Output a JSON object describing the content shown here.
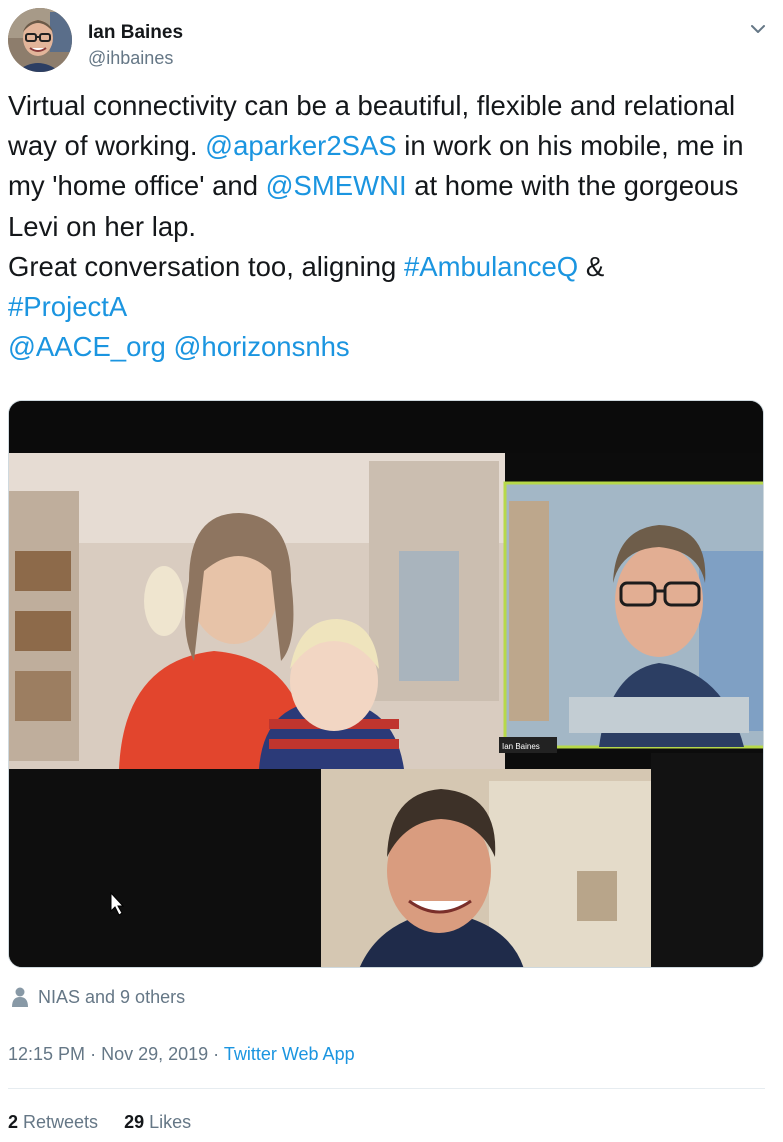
{
  "author": {
    "name": "Ian Baines",
    "handle": "@ihbaines"
  },
  "tweet": {
    "segments": [
      {
        "text": "Virtual connectivity can be a beautiful, flexible and relational way of working. ",
        "type": "text"
      },
      {
        "text": "@aparker2SAS",
        "type": "mention"
      },
      {
        "text": " in work on his mobile, me in my 'home office' and ",
        "type": "text"
      },
      {
        "text": "@SMEWNI",
        "type": "mention"
      },
      {
        "text": " at home with the gorgeous Levi on her lap.",
        "type": "text"
      },
      {
        "text": "\n",
        "type": "break"
      },
      {
        "text": "Great conversation too, aligning ",
        "type": "text"
      },
      {
        "text": "#AmbulanceQ",
        "type": "hashtag"
      },
      {
        "text": " &",
        "type": "text"
      },
      {
        "text": "\n",
        "type": "break"
      },
      {
        "text": "#ProjectA",
        "type": "hashtag"
      },
      {
        "text": "\n",
        "type": "break"
      },
      {
        "text": "@AACE_org",
        "type": "mention"
      },
      {
        "text": " ",
        "type": "text"
      },
      {
        "text": "@horizonsnhs",
        "type": "mention"
      }
    ]
  },
  "media": {
    "video_tile_label": "Ian Baines"
  },
  "likers": {
    "text": "NIAS and 9 others"
  },
  "meta": {
    "time": "12:15 PM",
    "separator": "·",
    "date": "Nov 29, 2019",
    "source": "Twitter Web App"
  },
  "stats": {
    "retweets_count": "2",
    "retweets_label": "Retweets",
    "likes_count": "29",
    "likes_label": "Likes"
  },
  "colors": {
    "link": "#1b95e0",
    "secondary": "#657786",
    "text": "#14171a",
    "active_speaker_border": "#b7d94a"
  }
}
